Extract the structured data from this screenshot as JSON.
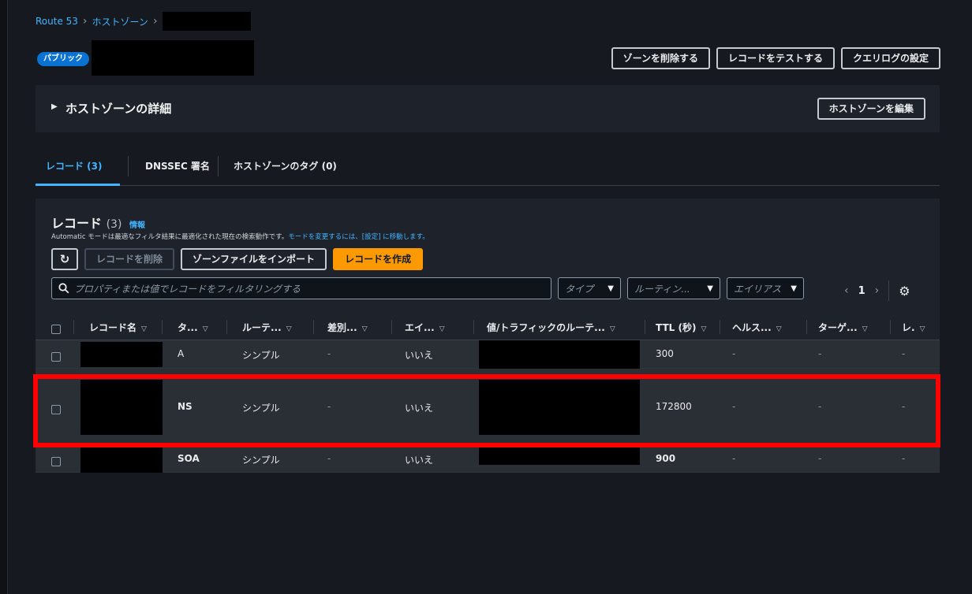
{
  "breadcrumb": {
    "root": "Route 53",
    "hosted_zones": "ホストゾーン"
  },
  "header": {
    "badge": "パブリック",
    "buttons": {
      "delete_zone": "ゾーンを削除する",
      "test_record": "レコードをテストする",
      "query_log": "クエリログの設定"
    }
  },
  "details": {
    "caret": "▶",
    "title": "ホストゾーンの詳細",
    "edit_button": "ホストゾーンを編集"
  },
  "tabs": [
    {
      "label": "レコード (3)",
      "active": true
    },
    {
      "label": "DNSSEC 署名",
      "active": false
    },
    {
      "label": "ホストゾーンのタグ (0)",
      "active": false
    }
  ],
  "records": {
    "title": "レコード",
    "count": "(3)",
    "info": "情報",
    "description_main": "Automatic モードは最適なフィルタ結果に最適化された現在の検索動作です。",
    "description_link": "モードを変更するには、[設定] に移動します。",
    "toolbar": {
      "refresh_icon": "refresh-icon",
      "delete": "レコードを削除",
      "import": "ゾーンファイルをインポート",
      "create": "レコードを作成"
    },
    "search_placeholder": "プロパティまたは値でレコードをフィルタリングする",
    "filters": {
      "type": "タイプ",
      "routing": "ルーティン...",
      "alias": "エイリアス"
    },
    "pagination": {
      "current_page": "1"
    },
    "columns": [
      "レコード名",
      "タ...",
      "ルーテ...",
      "差別...",
      "エイ...",
      "値/トラフィックのルーテ...",
      "TTL (秒)",
      "ヘルス...",
      "ターゲ...",
      "レ."
    ],
    "rows": [
      {
        "type": "A",
        "routing": "シンプル",
        "differentiator": "-",
        "alias": "いいえ",
        "ttl": "300",
        "health": "-",
        "target": "-",
        "record_id": "-"
      },
      {
        "type": "NS",
        "routing": "シンプル",
        "differentiator": "-",
        "alias": "いいえ",
        "ttl": "172800",
        "health": "-",
        "target": "-",
        "record_id": "-"
      },
      {
        "type": "SOA",
        "routing": "シンプル",
        "differentiator": "-",
        "alias": "いいえ",
        "ttl": "900",
        "health": "-",
        "target": "-",
        "record_id": "-"
      }
    ]
  },
  "colors": {
    "accent_link": "#42b4ff",
    "primary_button": "#ff9900",
    "highlight": "#ff0000",
    "badge": "#0972d3"
  }
}
